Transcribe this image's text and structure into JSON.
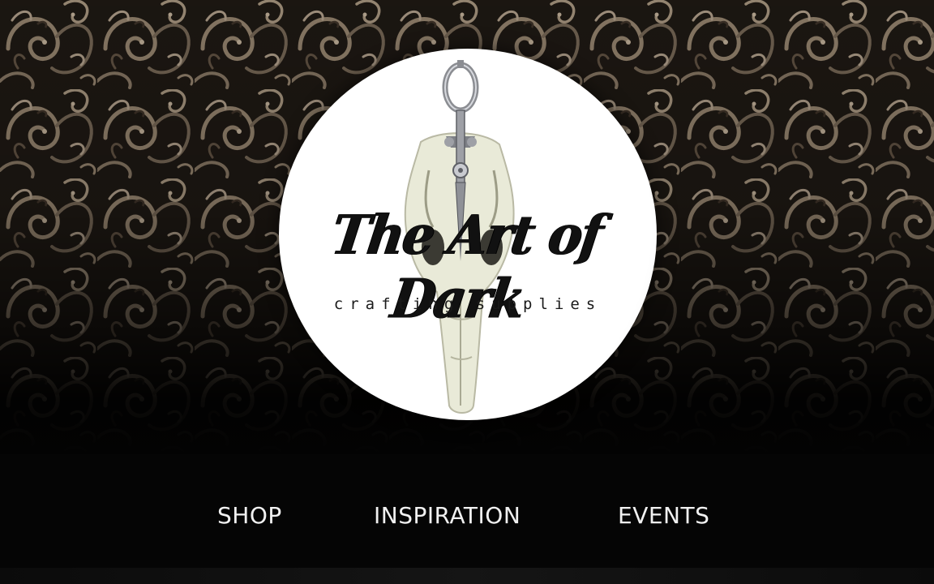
{
  "brand": {
    "title": "The Art of Dark",
    "subtitle": "crafting supplies"
  },
  "nav": {
    "items": [
      {
        "label": "SHOP"
      },
      {
        "label": "INSPIRATION"
      },
      {
        "label": "EVENTS"
      }
    ]
  },
  "colors": {
    "page_background": "#050505",
    "pattern_dark": "#1a140f",
    "pattern_light": "#8a7a66",
    "logo_disc": "#ffffff",
    "nav_text": "#f1f1f1"
  },
  "icons": {
    "logo": "skull-and-scissors-logo",
    "background": "ornamental-scroll-pattern"
  }
}
